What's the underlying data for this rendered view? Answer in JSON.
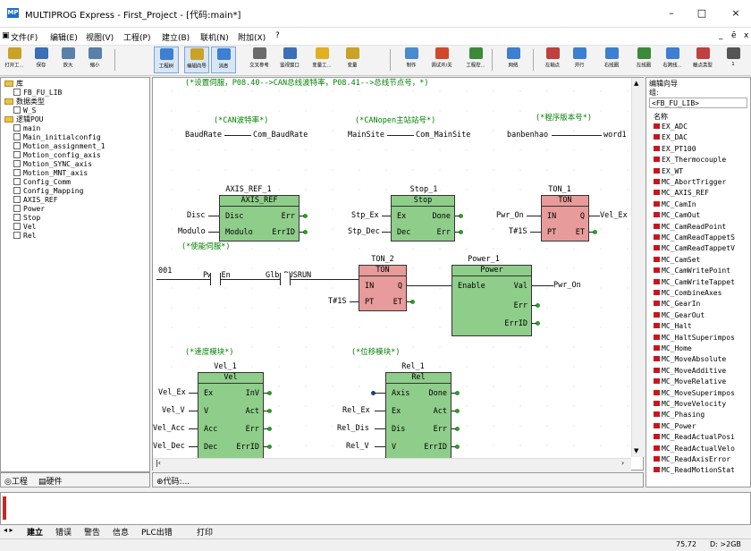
{
  "window": {
    "title": "MULTIPROG Express - First_Project - [代码:main*]",
    "app_icon_text": "MP",
    "minimize": "–",
    "maximize": "□",
    "close": "×"
  },
  "menu": [
    "文件(F)",
    "编辑(E)",
    "视图(V)",
    "工程(P)",
    "建立(B)",
    "联机(N)",
    "附加(X)",
    "?"
  ],
  "menu_right": [
    "_",
    "ē",
    "x"
  ],
  "toolbar": [
    {
      "label": "打开工...",
      "icon": "open-project-icon",
      "color": "#c9a227"
    },
    {
      "label": "保存",
      "icon": "save-icon",
      "color": "#3b6fb6"
    },
    {
      "label": "放大",
      "icon": "zoom-in-icon",
      "color": "#5a7fa8"
    },
    {
      "label": "缩小",
      "icon": "zoom-out-icon",
      "color": "#5a7fa8"
    },
    {
      "label": "工程树",
      "icon": "project-tree-icon",
      "color": "#3d7fd0"
    },
    {
      "label": "编辑向导",
      "icon": "edit-wizard-icon",
      "color": "#c9a227"
    },
    {
      "label": "消息",
      "icon": "message-icon",
      "color": "#3d7fd0"
    },
    {
      "label": "交叉参考",
      "icon": "cross-reference-icon",
      "color": "#6b6b6b"
    },
    {
      "label": "监视窗口",
      "icon": "watch-window-icon",
      "color": "#3b6fb6"
    },
    {
      "label": "变量工...",
      "icon": "variables-icon",
      "color": "#e0b020"
    },
    {
      "label": "变量",
      "icon": "variable-icon",
      "color": "#c9a227"
    },
    {
      "label": "制作",
      "icon": "make-icon",
      "color": "#4a8bd0"
    },
    {
      "label": "调试开/关",
      "icon": "debug-toggle-icon",
      "color": "#d04a2a"
    },
    {
      "label": "工程控...",
      "icon": "project-control-icon",
      "color": "#3a8a3a"
    },
    {
      "label": "网络",
      "icon": "network-icon",
      "color": "#3d7fd0"
    },
    {
      "label": "左轴点",
      "icon": "left-rail-icon",
      "color": "#c04040"
    },
    {
      "label": "并行",
      "icon": "parallel-icon",
      "color": "#3d7fd0"
    },
    {
      "label": "右线圈",
      "icon": "right-coil-icon",
      "color": "#3d7fd0"
    },
    {
      "label": "左线圈",
      "icon": "left-coil-icon",
      "color": "#3a8a3a"
    },
    {
      "label": "右跨线...",
      "icon": "right-jumper-icon",
      "color": "#3d7fd0"
    },
    {
      "label": "触点类型",
      "icon": "contact-type-icon",
      "color": "#c04040"
    },
    {
      "label": "1",
      "icon": "more-icon",
      "color": "#555555"
    }
  ],
  "tree": [
    {
      "label": "库",
      "kind": "folder"
    },
    {
      "label": "FB_FU_LIB",
      "kind": "lib"
    },
    {
      "label": "数据类型",
      "kind": "folder"
    },
    {
      "label": "W_S",
      "kind": "file"
    },
    {
      "label": "逻辑POU",
      "kind": "folder"
    },
    {
      "label": "main",
      "kind": "file"
    },
    {
      "label": "Main_initialconfig",
      "kind": "file"
    },
    {
      "label": "Motion_assignment_1",
      "kind": "file"
    },
    {
      "label": "Motion_config_axis",
      "kind": "file"
    },
    {
      "label": "Motion_SYNC_axis",
      "kind": "file"
    },
    {
      "label": "Motion_MNT_axis",
      "kind": "file"
    },
    {
      "label": "Config_Comm",
      "kind": "file"
    },
    {
      "label": "Config_Mapping",
      "kind": "file"
    },
    {
      "label": "AXIS_REF",
      "kind": "file"
    },
    {
      "label": "Power",
      "kind": "file"
    },
    {
      "label": "Stop",
      "kind": "file"
    },
    {
      "label": "Vel",
      "kind": "file"
    },
    {
      "label": "Rel",
      "kind": "file"
    }
  ],
  "left_tabs": [
    "工程",
    "硬件"
  ],
  "editor": {
    "tab_label": "代码:...",
    "comments": {
      "top": "(*设置伺服，P08.40-->CAN总线波特率，P08.41-->总线节点号，*)",
      "baud": "(*CAN波特率*)",
      "canopen": "(*CANopen主站站号*)",
      "version": "(*程序版本号*)",
      "enable": "(*使能伺服*)",
      "speed": "(*速度模块*)",
      "position": "(*位移模块*)"
    },
    "assignments": {
      "baud_left": "BaudRate",
      "baud_right": "Com_BaudRate",
      "main_left": "MainSite",
      "main_right": "Com_MainSite",
      "ver_left": "banbenhao",
      "ver_right": "word1"
    },
    "blocks": {
      "axis": {
        "instance": "AXIS_REF_1",
        "type": "AXIS_REF",
        "in1": "Disc",
        "in2": "Modulo",
        "out1": "Err",
        "out2": "ErrID",
        "var1": "Disc",
        "var2": "Modulo"
      },
      "stop": {
        "instance": "Stop_1",
        "type": "Stop",
        "in1": "Ex",
        "in2": "Dec",
        "out1": "Done",
        "out2": "Err",
        "var1": "Stp_Ex",
        "var2": "Stp_Dec"
      },
      "ton1": {
        "instance": "TON_1",
        "type": "TON",
        "in1": "IN",
        "in2": "PT",
        "out1": "Q",
        "out2": "ET",
        "var1": "Pwr_On",
        "var2": "T#1S",
        "var_out": "Vel_Ex"
      },
      "ton2": {
        "instance": "TON_2",
        "type": "TON",
        "in1": "IN",
        "in2": "PT",
        "out1": "Q",
        "out2": "ET",
        "var2": "T#1S"
      },
      "power": {
        "instance": "Power_1",
        "type": "Power",
        "in1": "Enable",
        "out1": "Val",
        "out2": "Err",
        "out3": "ErrID",
        "var_out": "Pwr_On"
      },
      "vel": {
        "instance": "Vel_1",
        "type": "Vel",
        "in1": "Ex",
        "in2": "V",
        "in3": "Acc",
        "in4": "Dec",
        "out1": "InV",
        "out2": "Act",
        "out3": "Err",
        "out4": "ErrID",
        "var1": "Vel_Ex",
        "var2": "Vel_V",
        "var3": "Vel_Acc",
        "var4": "Vel_Dec"
      },
      "rel": {
        "instance": "Rel_1",
        "type": "Rel",
        "in1": "Axis",
        "in2": "Ex",
        "in3": "Dis",
        "in4": "V",
        "out1": "Done",
        "out2": "Act",
        "out3": "Err",
        "out4": "ErrID",
        "var2": "Rel_Ex",
        "var3": "Rel_Dis",
        "var4": "Rel_V"
      }
    },
    "ladder": {
      "rung": "001",
      "contact1": "Pwr_En",
      "contact2": "Glb_BUSRUN"
    }
  },
  "right_pane": {
    "title": "编辑向导",
    "group_label": "组:",
    "group_value": "<FB_FU_LIB>",
    "column": "名称",
    "items": [
      "EX_ADC",
      "EX_DAC",
      "EX_PT100",
      "EX_Thermocouple",
      "EX_WT",
      "MC_AbortTrigger",
      "MC_AXIS_REF",
      "MC_CamIn",
      "MC_CamOut",
      "MC_CamReadPoint",
      "MC_CamReadTappetS",
      "MC_CamReadTappetV",
      "MC_CamSet",
      "MC_CamWritePoint",
      "MC_CamWriteTappet",
      "MC_CombineAxes",
      "MC_GearIn",
      "MC_GearOut",
      "MC_Halt",
      "MC_HaltSuperimpos",
      "MC_Home",
      "MC_MoveAbsolute",
      "MC_MoveAdditive",
      "MC_MoveRelative",
      "MC_MoveSuperimpos",
      "MC_MoveVelocity",
      "MC_Phasing",
      "MC_Power",
      "MC_ReadActualPosi",
      "MC_ReadActualVelo",
      "MC_ReadAxisError",
      "MC_ReadMotionStat"
    ]
  },
  "output_tabs": [
    "建立",
    "错误",
    "警告",
    "信息",
    "PLC出错",
    "打印"
  ],
  "status": {
    "left": "75.72",
    "right": "D: >2GB"
  }
}
